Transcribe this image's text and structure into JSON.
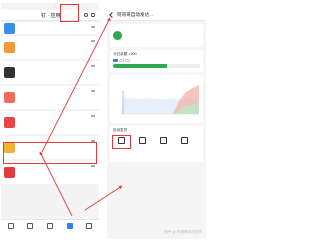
{
  "left_phone": {
    "status": {
      "time": "",
      "right": ""
    },
    "header": {
      "title": "钉 · 应用"
    },
    "items": [
      {
        "name": "",
        "sub": "",
        "color": "#3b8ee8",
        "short": true
      },
      {
        "name": "",
        "sub": "",
        "color": "#f39a37",
        "short": false
      },
      {
        "name": "",
        "sub": "",
        "color": "#333333",
        "short": false
      },
      {
        "name": "",
        "sub": "",
        "color": "#f26b5b",
        "short": false
      },
      {
        "name": "",
        "sub": "",
        "color": "#e84545",
        "short": false
      },
      {
        "name": "",
        "sub": "",
        "color": "#f2b233",
        "short": false
      },
      {
        "name": "",
        "sub": "",
        "color": "#e23b3b",
        "short": false
      }
    ],
    "bottom_nav": [
      {
        "label": "",
        "active": false
      },
      {
        "label": "",
        "active": false
      },
      {
        "label": "",
        "active": false
      },
      {
        "label": "",
        "active": true
      },
      {
        "label": "",
        "active": false
      }
    ]
  },
  "right_phone": {
    "status": {
      "time": "",
      "right": ""
    },
    "header": {
      "title": "阿哥哥自动发达..."
    },
    "card": {
      "title": "",
      "sub": ""
    },
    "section": {
      "title": "今日余额 >200",
      "tabs": [
        "",
        "",
        ""
      ],
      "progress": 0.62,
      "stats": [
        "",
        "",
        ""
      ]
    },
    "chart": {
      "title": "",
      "dates": [
        "",
        "",
        ""
      ]
    },
    "functions": {
      "title": "自动发货",
      "items": [
        {
          "label": ""
        },
        {
          "label": ""
        },
        {
          "label": ""
        },
        {
          "label": ""
        }
      ]
    }
  },
  "watermark": "知乎 @ 阿哥哥自动发货",
  "colors": {
    "accent": "#2f7ff5",
    "highlight": "#e23b3b",
    "green": "#2fa84f"
  },
  "chart_data": {
    "type": "area",
    "x": [],
    "series": []
  }
}
